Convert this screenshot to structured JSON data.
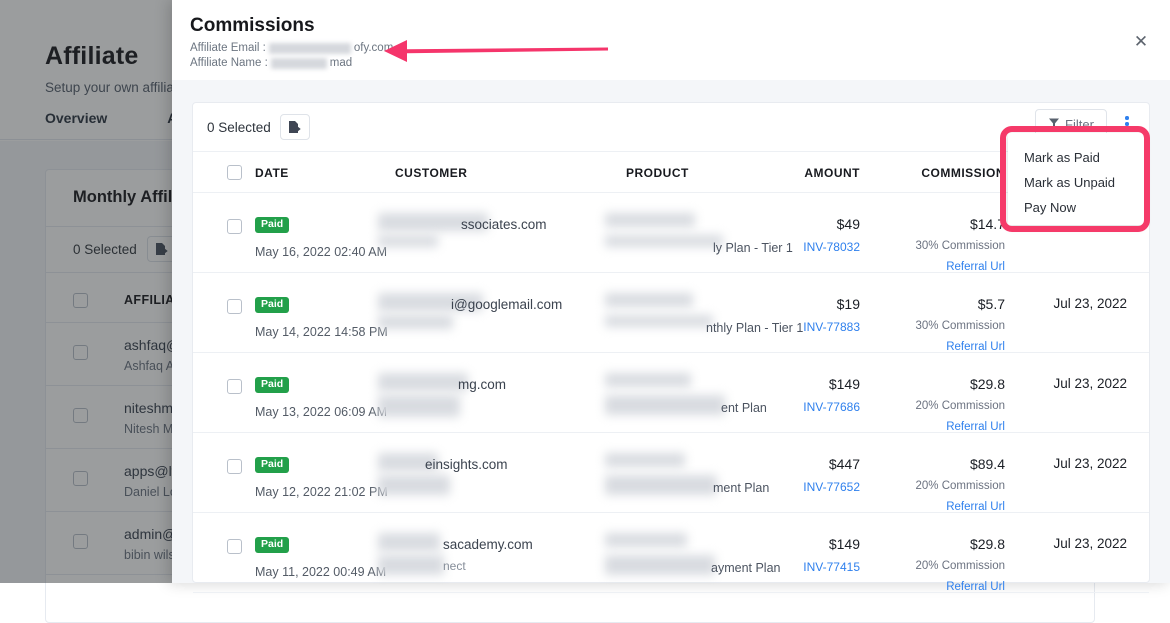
{
  "background_page": {
    "title": "Affiliate",
    "subtitle": "Setup your own affiliate p",
    "tabs": [
      {
        "label": "Overview"
      },
      {
        "label": "Af"
      }
    ],
    "card_title": "Monthly Affiliate",
    "selected_label": "0 Selected",
    "export_icon": "export-file-icon",
    "columns": [
      {
        "label": "AFFILIATE EMA"
      }
    ],
    "rows": [
      {
        "email": "ashfaq@techlo",
        "name": "Ashfaq Ahmad"
      },
      {
        "email": "niteshmanav@",
        "name": "Nitesh Manav"
      },
      {
        "email": "apps@ltdhunt",
        "name": "Daniel Lourenço"
      },
      {
        "email": "admin@comte",
        "name": "bibin wilson"
      }
    ]
  },
  "modal": {
    "title": "Commissions",
    "email_label": "Affiliate Email :",
    "email_value_visible": "ofy.com",
    "name_label": "Affiliate Name :",
    "name_value_visible": "mad",
    "close_icon": "close-icon",
    "toolbar": {
      "selected_label": "0 Selected",
      "export_icon": "export-file-icon",
      "filter_label": "Filter",
      "filter_icon": "funnel-icon",
      "kebab_icon": "more-vertical-icon"
    },
    "columns": [
      {
        "key": "date",
        "label": "DATE"
      },
      {
        "key": "customer",
        "label": "CUSTOMER"
      },
      {
        "key": "product",
        "label": "PRODUCT"
      },
      {
        "key": "amount",
        "label": "AMOUNT"
      },
      {
        "key": "commission",
        "label": "COMMISSION"
      }
    ],
    "rows": [
      {
        "status": "Paid",
        "date": "May 16, 2022 02:40 AM",
        "customer_email": "ssociates.com",
        "product": "ly Plan - Tier 1",
        "amount": "$49",
        "invoice": "INV-78032",
        "commission": "$14.7",
        "commission_rate": "30% Commission",
        "referral_label": "Referral Url",
        "paid_date": ""
      },
      {
        "status": "Paid",
        "date": "May 14, 2022 14:58 PM",
        "customer_email": "i@googlemail.com",
        "product": "nthly Plan - Tier 1",
        "amount": "$19",
        "invoice": "INV-77883",
        "commission": "$5.7",
        "commission_rate": "30% Commission",
        "referral_label": "Referral Url",
        "paid_date": "Jul 23, 2022"
      },
      {
        "status": "Paid",
        "date": "May 13, 2022 06:09 AM",
        "customer_email": "mg.com",
        "product": "ent Plan",
        "amount": "$149",
        "invoice": "INV-77686",
        "commission": "$29.8",
        "commission_rate": "20% Commission",
        "referral_label": "Referral Url",
        "paid_date": "Jul 23, 2022"
      },
      {
        "status": "Paid",
        "date": "May 12, 2022 21:02 PM",
        "customer_email": "einsights.com",
        "product": "ment Plan",
        "amount": "$447",
        "invoice": "INV-77652",
        "commission": "$89.4",
        "commission_rate": "20% Commission",
        "referral_label": "Referral Url",
        "paid_date": "Jul 23, 2022"
      },
      {
        "status": "Paid",
        "date": "May 11, 2022 00:49 AM",
        "customer_email": "sacademy.com",
        "customer_sub": "nect",
        "product": "ayment Plan",
        "amount": "$149",
        "invoice": "INV-77415",
        "commission": "$29.8",
        "commission_rate": "20% Commission",
        "referral_label": "Referral Url",
        "paid_date": "Jul 23, 2022"
      }
    ]
  },
  "dropdown": {
    "items": [
      {
        "label": "Mark as Paid"
      },
      {
        "label": "Mark as Unpaid"
      },
      {
        "label": "Pay Now"
      }
    ]
  },
  "annotations": {
    "highlight_color": "#f53a69",
    "arrow_color": "#f5356b",
    "arrow_direction": "left"
  }
}
